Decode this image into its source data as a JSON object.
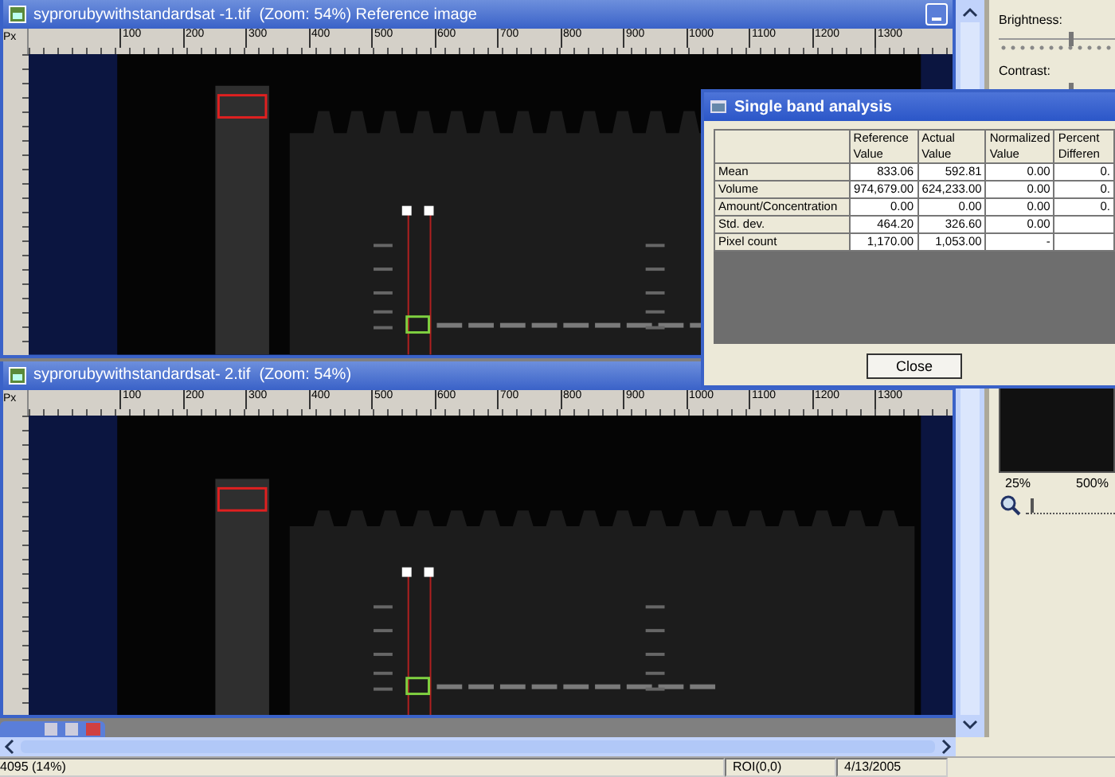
{
  "windows": [
    {
      "title": "syprorubywithstandardsat -1.tif  (Zoom: 54%) Reference image",
      "ruler_unit": "Px",
      "ruler_labels": [
        "100",
        "200",
        "300",
        "400",
        "500",
        "600",
        "700",
        "800",
        "900",
        "1000",
        "1100",
        "1200",
        "1300"
      ],
      "minimize_button": true
    },
    {
      "title": "syprorubywithstandardsat- 2.tif  (Zoom: 54%)",
      "ruler_unit": "Px",
      "ruler_labels": [
        "100",
        "200",
        "300",
        "400",
        "500",
        "600",
        "700",
        "800",
        "900",
        "1000",
        "1100",
        "1200",
        "1300"
      ],
      "minimize_button": false
    }
  ],
  "side_panel": {
    "sliders": [
      {
        "label": "Brightness:",
        "level": 0.6
      },
      {
        "label": "Contrast:",
        "level": 0.6
      }
    ],
    "zoom_min": "25%",
    "zoom_max": "500%",
    "zoom_slider": {
      "level": 0.05
    }
  },
  "dialog": {
    "title": "Single band analysis",
    "columns": [
      "Reference Value",
      "Actual Value",
      "Normalized Value",
      "Percent Differen"
    ],
    "rows": [
      {
        "label": "Mean",
        "values": [
          "833.06",
          "592.81",
          "0.00",
          "0."
        ]
      },
      {
        "label": "Volume",
        "values": [
          "974,679.00",
          "624,233.00",
          "0.00",
          "0."
        ]
      },
      {
        "label": "Amount/Concentration",
        "values": [
          "0.00",
          "0.00",
          "0.00",
          "0."
        ]
      },
      {
        "label": "Std. dev.",
        "values": [
          "464.20",
          "326.60",
          "0.00"
        ]
      },
      {
        "label": "Pixel count",
        "values": [
          "1,170.00",
          "1,053.00",
          "-"
        ]
      }
    ],
    "close_button": "Close"
  },
  "status_bar": [
    "4095 (14%)",
    "ROI(0,0)",
    "4/13/2005"
  ]
}
